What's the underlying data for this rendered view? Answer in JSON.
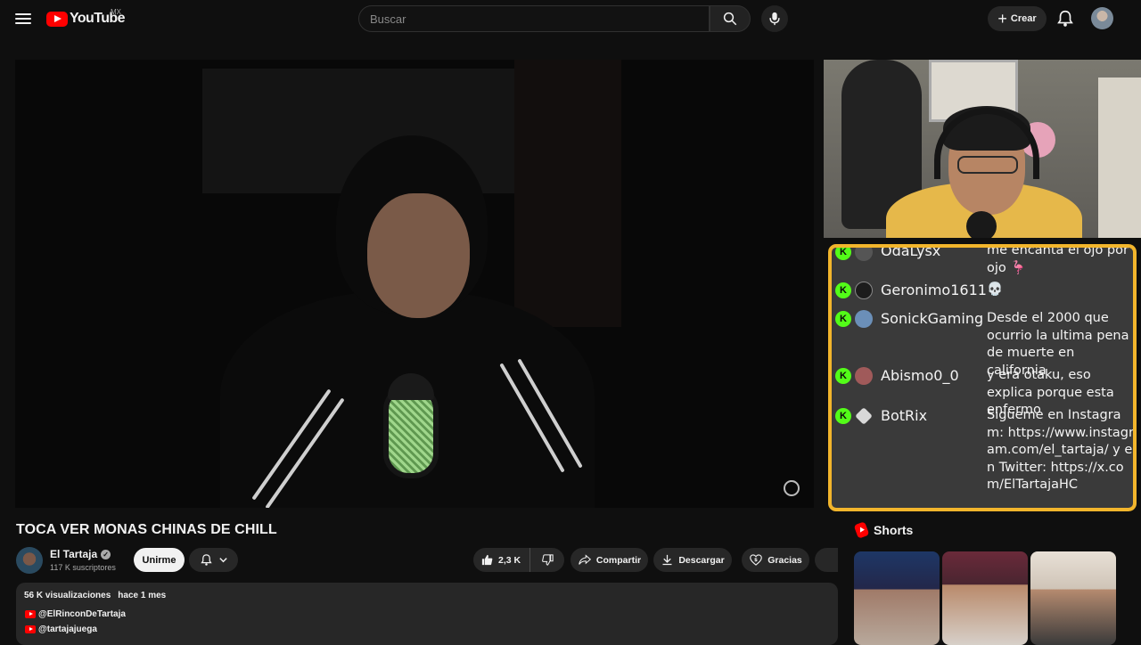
{
  "header": {
    "logo_text": "YouTube",
    "country_code": "MX",
    "search_placeholder": "Buscar",
    "create_label": "Crear"
  },
  "video": {
    "title": "TOCA VER MONAS CHINAS DE CHILL"
  },
  "chat": {
    "messages": [
      {
        "user": "OdaLysx",
        "text": "me encanta el ojo por ojo 🦩",
        "avatar_color": "#555555"
      },
      {
        "user": "Geronimo1611",
        "text": "💀",
        "avatar_color": "#1c1c1c"
      },
      {
        "user": "SonickGaming",
        "text": "Desde el 2000 que ocurrio la ultima pena de muerte en california",
        "avatar_color": "#6b8fb8"
      },
      {
        "user": "Abismo0_0",
        "text": "y era otaku, eso explica porque esta enfermo",
        "avatar_color": "#a05a5a"
      },
      {
        "user": "BotRix",
        "text": "Sigueme en Instagram: https://www.instagram.com/el_tartaja/ y en Twitter: https://x.com/ElTartajaHC",
        "avatar_color": "#d8d8d8"
      }
    ],
    "badge_letter": "K",
    "border_color": "#f2b52c",
    "badge_color": "#53fc18"
  },
  "channel": {
    "name": "El Tartaja",
    "subscribers": "117 K suscriptores",
    "join_label": "Unirme"
  },
  "actions": {
    "likes": "2,3 K",
    "share_label": "Compartir",
    "download_label": "Descargar",
    "thanks_label": "Gracias"
  },
  "description": {
    "views": "56 K visualizaciones",
    "date": "hace 1 mes",
    "links": [
      "@ElRinconDeTartaja",
      "@tartajajuega"
    ]
  },
  "shorts": {
    "title": "Shorts"
  },
  "icons": [
    "menu-icon",
    "youtube-logo-icon",
    "search-icon",
    "mic-icon",
    "plus-icon",
    "bell-icon",
    "verified-icon",
    "like-icon",
    "dislike-icon",
    "share-icon",
    "download-icon",
    "thanks-icon",
    "shorts-icon"
  ]
}
